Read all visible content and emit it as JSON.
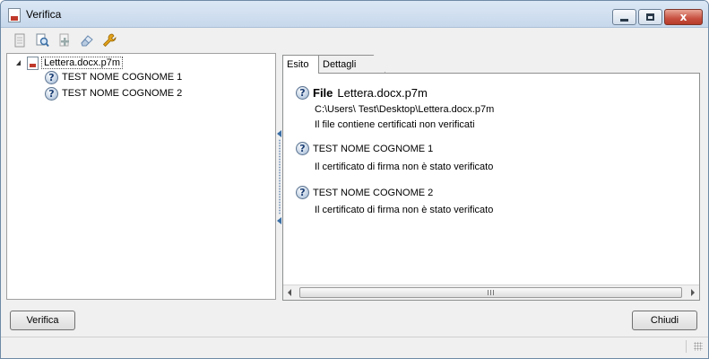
{
  "window": {
    "title": "Verifica"
  },
  "toolbar": {
    "icons": [
      "document-icon",
      "magnify-icon",
      "add-document-icon",
      "eraser-icon",
      "wrench-icon"
    ]
  },
  "tree": {
    "root_label": "Lettera.docx.p7m",
    "children": [
      "TEST NOME COGNOME 1",
      "TEST NOME COGNOME 2"
    ]
  },
  "tabs": {
    "esito": "Esito",
    "dettagli": "Dettagli"
  },
  "esito": {
    "file_word": "File",
    "file_name": "Lettera.docx.p7m",
    "file_path": "C:\\Users\\ Test\\Desktop\\Lettera.docx.p7m",
    "file_status": "Il file contiene certificati non verificati",
    "signers": [
      {
        "name": "TEST NOME COGNOME 1",
        "status": "Il certificato di firma non è stato verificato"
      },
      {
        "name": "TEST NOME COGNOME 2",
        "status": "Il certificato di firma non è stato verificato"
      }
    ]
  },
  "buttons": {
    "verifica": "Verifica",
    "chiudi": "Chiudi"
  },
  "icon_glyphs": {
    "question": "?",
    "close": "x"
  },
  "colors": {
    "titlebar": "#c7d8ec",
    "close_button": "#c75041",
    "accent": "#3a6ea5"
  }
}
